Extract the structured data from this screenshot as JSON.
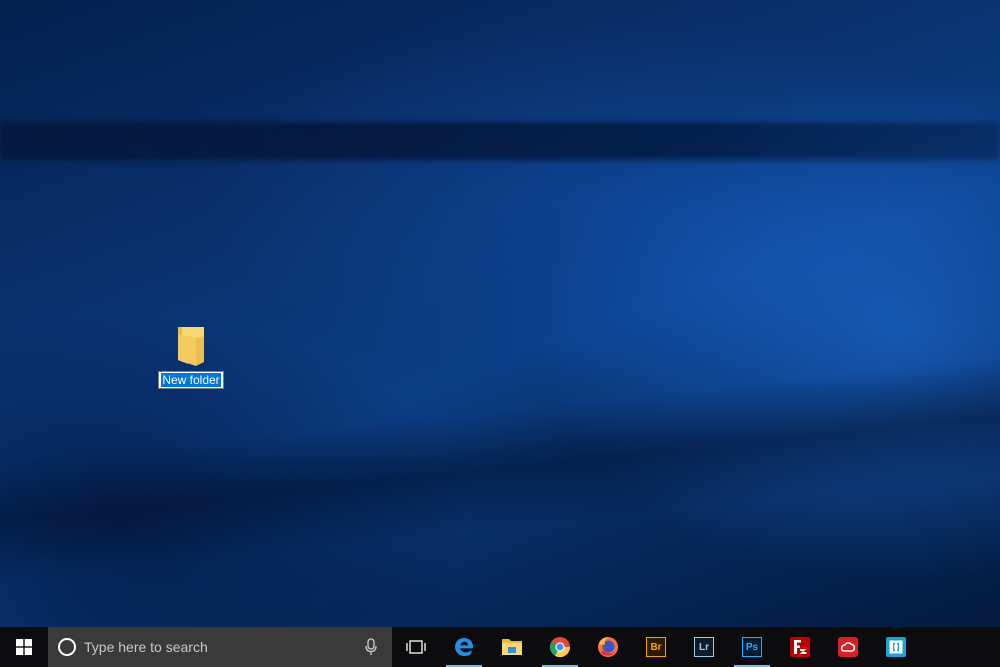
{
  "desktop": {
    "items": [
      {
        "label": "New folder",
        "state": "renaming"
      }
    ]
  },
  "taskbar": {
    "search": {
      "placeholder": "Type here to search"
    },
    "pinned_apps": [
      {
        "name": "Microsoft Edge",
        "icon": "edge-icon",
        "running": true
      },
      {
        "name": "File Explorer",
        "icon": "folder-icon",
        "running": false
      },
      {
        "name": "Google Chrome",
        "icon": "chrome-icon",
        "running": true
      },
      {
        "name": "Firefox",
        "icon": "firefox-icon",
        "running": false
      },
      {
        "name": "Adobe Bridge",
        "icon": "bridge-icon",
        "badge": "Br",
        "color": "#f0a800",
        "running": false
      },
      {
        "name": "Adobe Lightroom",
        "icon": "lightroom-icon",
        "badge": "Lr",
        "color": "#9bcbe8",
        "running": false
      },
      {
        "name": "Adobe Photoshop",
        "icon": "photoshop-icon",
        "badge": "Ps",
        "color": "#31a8ff",
        "running": true
      },
      {
        "name": "FileZilla",
        "icon": "filezilla-icon",
        "running": false
      },
      {
        "name": "Adobe Creative Cloud",
        "icon": "creative-cloud-icon",
        "running": false
      },
      {
        "name": "Remote app",
        "icon": "bracket-app-icon",
        "running": false
      }
    ]
  },
  "colors": {
    "selection": "#0078d7",
    "taskbar": "#0c0c0e",
    "search_box": "#3a3a3a",
    "running_indicator": "#76b9ed"
  }
}
